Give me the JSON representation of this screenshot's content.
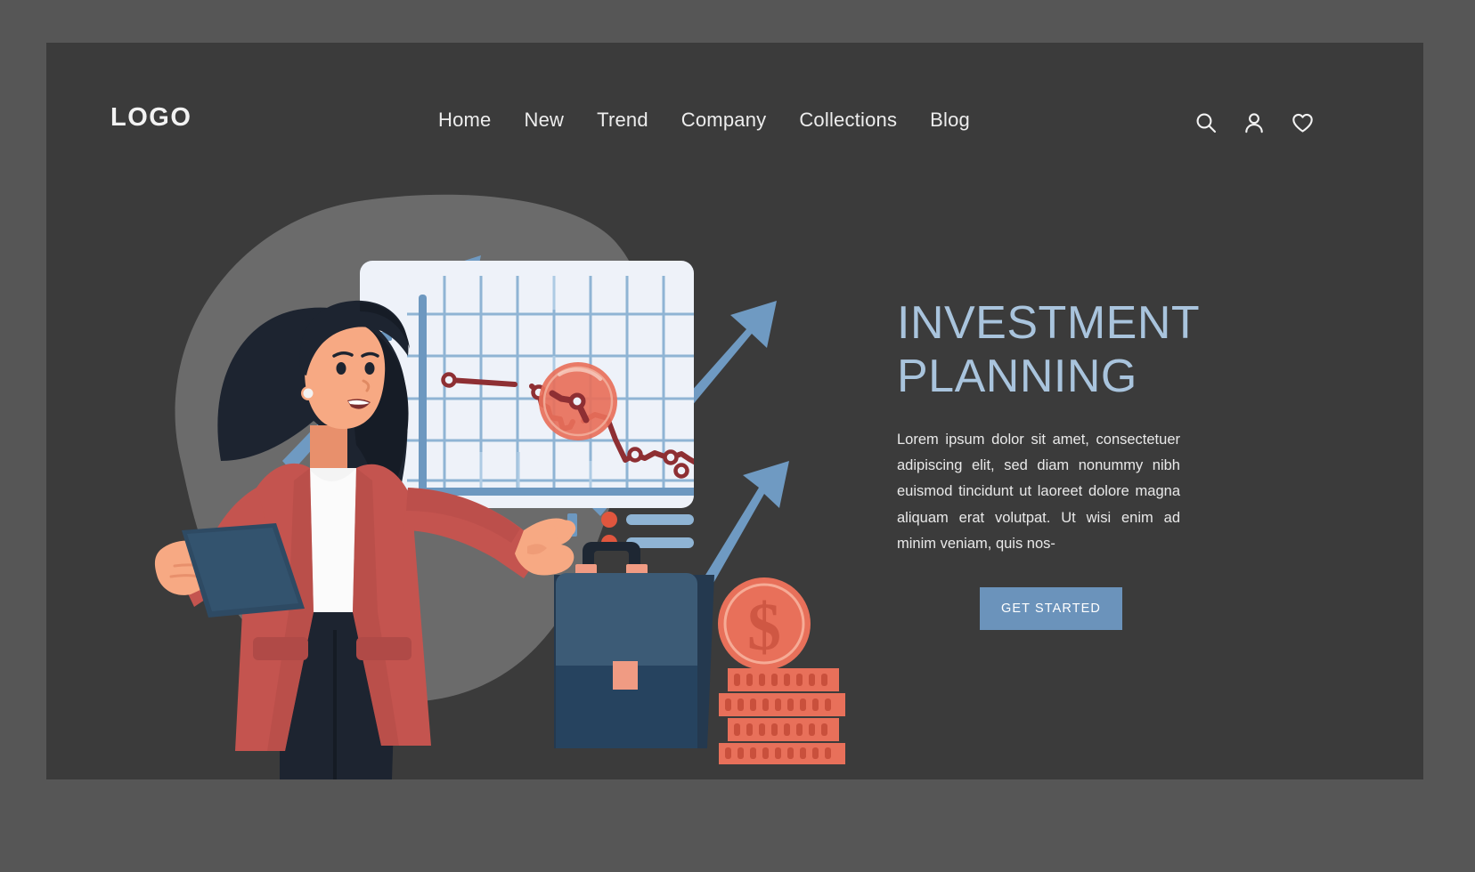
{
  "header": {
    "logo": "LOGO",
    "nav": [
      {
        "label": "Home"
      },
      {
        "label": "New"
      },
      {
        "label": "Trend"
      },
      {
        "label": "Company"
      },
      {
        "label": "Collections"
      },
      {
        "label": "Blog"
      }
    ],
    "icons": [
      {
        "name": "search-icon"
      },
      {
        "name": "user-icon"
      },
      {
        "name": "heart-icon"
      }
    ]
  },
  "hero": {
    "headline": "INVESTMENT PLANNING",
    "body": "Lorem ipsum dolor sit amet, consectetuer adipiscing elit, sed diam nonummy nibh euismod tincidunt ut laoreet dolore magna aliquam erat volutpat. Ut wisi enim ad minim veniam, quis nos-",
    "cta_label": "GET STARTED"
  },
  "illustration": {
    "alt": "businesswoman presenting a declining stock chart with briefcase, dollar coin and coin stack",
    "chart_title": "declining-trend-line-chart",
    "magnifier_label": "magnifier-on-chart",
    "briefcase_label": "briefcase",
    "coin_label": "dollar-coin",
    "coin_stack_label": "coin-stack"
  },
  "colors": {
    "page_background": "#565656",
    "panel_background": "#3b3b3b",
    "accent_blue": "#6b93bb",
    "headline_blue": "#a9c4dd",
    "text_light": "#e9e9e9",
    "jacket_red": "#c4544f",
    "coin_red": "#e8705a",
    "chart_board": "#eef2f9",
    "chart_grid": "#7fa8cc",
    "line_dark_red": "#8e2f33",
    "briefcase_blue": "#34536e",
    "hair_dark": "#1d2430",
    "skin": "#f2a077",
    "blob_gray": "#6b6b6b"
  },
  "chart_data": {
    "type": "line",
    "title": "declining-trend-line-chart",
    "xlabel": "",
    "ylabel": "",
    "grid": true,
    "legend": "bottom-left",
    "series": [
      {
        "name": "segment-1",
        "x": [
          0.5,
          1.4
        ],
        "y": [
          7.6,
          7.3
        ]
      },
      {
        "name": "segment-2",
        "x": [
          2.2,
          2.5,
          3.0,
          3.3,
          3.8,
          4.1,
          4.4
        ],
        "y": [
          7.0,
          6.4,
          6.2,
          5.4,
          5.2,
          5.1,
          4.4
        ]
      },
      {
        "name": "segment-3",
        "x": [
          5.2,
          5.8,
          6.0,
          6.6,
          7.2,
          7.6,
          8.2,
          8.6,
          9.1,
          9.6,
          10.0
        ],
        "y": [
          5.6,
          5.7,
          4.6,
          3.8,
          4.0,
          4.2,
          3.3,
          3.1,
          3.0,
          2.2,
          1.7
        ]
      }
    ],
    "xlim": [
      0,
      10
    ],
    "ylim": [
      0,
      9
    ]
  }
}
